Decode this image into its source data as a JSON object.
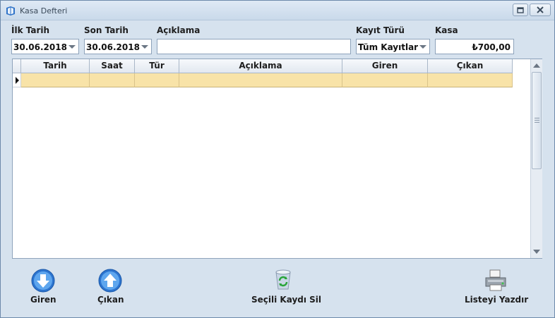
{
  "window": {
    "title": "Kasa Defteri"
  },
  "filters": {
    "ilk_tarih_label": "İlk Tarih",
    "ilk_tarih_value": "30.06.2018",
    "son_tarih_label": "Son Tarih",
    "son_tarih_value": "30.06.2018",
    "aciklama_label": "Açıklama",
    "aciklama_value": "",
    "kayit_turu_label": "Kayıt Türü",
    "kayit_turu_value": "Tüm Kayıtlar",
    "kasa_label": "Kasa",
    "kasa_value": "₺700,00"
  },
  "grid": {
    "columns": [
      "Tarih",
      "Saat",
      "Tür",
      "Açıklama",
      "Giren",
      "Çıkan"
    ],
    "rows": [
      [
        "",
        "",
        "",
        "",
        "",
        ""
      ]
    ]
  },
  "actions": {
    "giren_label": "Giren",
    "cikan_label": "Çıkan",
    "sil_label": "Seçili Kaydı Sil",
    "yazdir_label": "Listeyi Yazdır"
  },
  "colors": {
    "window_bg": "#d6e2ee",
    "selected_row": "#f8e3a8",
    "button_blue": "#3b8be0"
  }
}
